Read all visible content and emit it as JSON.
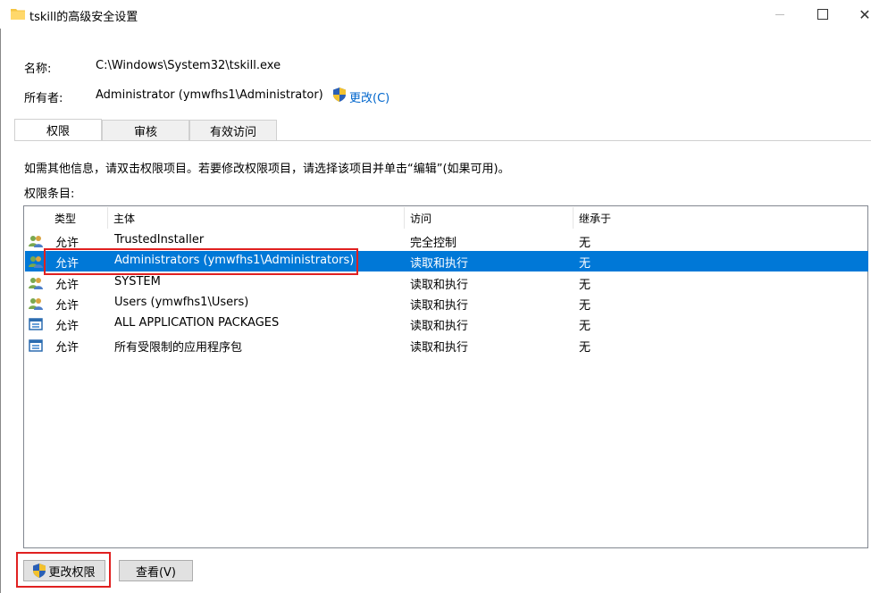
{
  "window": {
    "title": "tskill的高级安全设置",
    "minimize_icon": "minimize-icon",
    "maximize_icon": "maximize-icon",
    "close_glyph": "✕"
  },
  "info": {
    "name_label": "名称:",
    "name_value": "C:\\Windows\\System32\\tskill.exe",
    "owner_label": "所有者:",
    "owner_value": "Administrator (ymwfhs1\\Administrator)",
    "change_owner_link": "更改(C)"
  },
  "tabs": [
    {
      "label": "权限"
    },
    {
      "label": "审核"
    },
    {
      "label": "有效访问"
    }
  ],
  "instructions": "如需其他信息，请双击权限项目。若要修改权限项目，请选择该项目并单击“编辑”(如果可用)。",
  "entries_label": "权限条目:",
  "list": {
    "headers": [
      "类型",
      "主体",
      "访问",
      "继承于"
    ],
    "rows": [
      {
        "type": "允许",
        "principal": "TrustedInstaller",
        "access": "完全控制",
        "inherited": "无",
        "icon": "user-group-icon"
      },
      {
        "type": "允许",
        "principal": "Administrators (ymwfhs1\\Administrators)",
        "access": "读取和执行",
        "inherited": "无",
        "icon": "user-group-icon"
      },
      {
        "type": "允许",
        "principal": "SYSTEM",
        "access": "读取和执行",
        "inherited": "无",
        "icon": "user-group-icon"
      },
      {
        "type": "允许",
        "principal": "Users (ymwfhs1\\Users)",
        "access": "读取和执行",
        "inherited": "无",
        "icon": "user-group-icon"
      },
      {
        "type": "允许",
        "principal": "ALL APPLICATION PACKAGES",
        "access": "读取和执行",
        "inherited": "无",
        "icon": "app-package-icon"
      },
      {
        "type": "允许",
        "principal": "所有受限制的应用程序包",
        "access": "读取和执行",
        "inherited": "无",
        "icon": "app-package-icon"
      }
    ],
    "selected_index": 1
  },
  "buttons": {
    "change_permissions": "更改权限",
    "view": "查看(V)"
  },
  "colors": {
    "selection": "#0078d7",
    "highlight_box": "#e02020",
    "link": "#0066cc"
  }
}
